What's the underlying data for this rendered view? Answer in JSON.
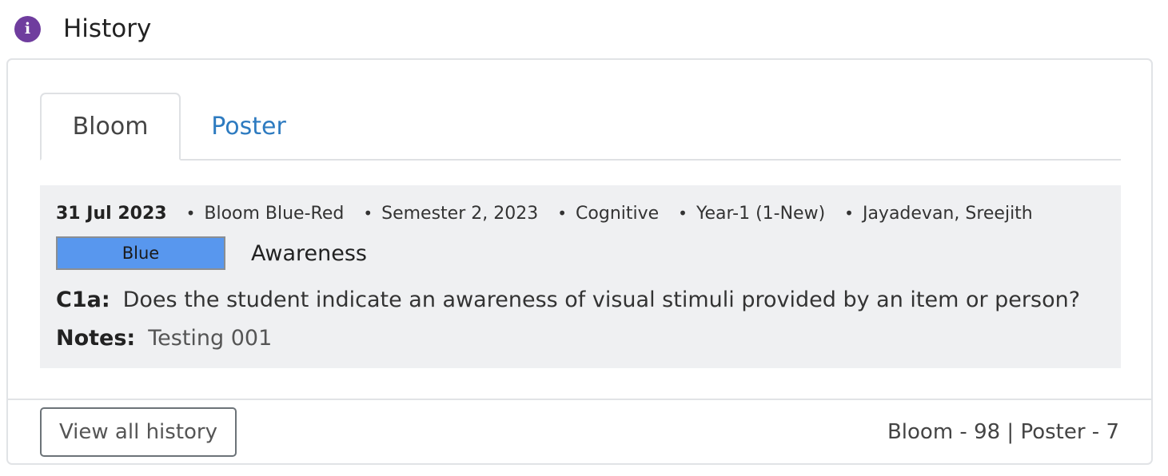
{
  "header": {
    "title": "History",
    "icon": "info-icon",
    "icon_glyph": "i"
  },
  "tabs": [
    {
      "label": "Bloom",
      "active": true
    },
    {
      "label": "Poster",
      "active": false
    }
  ],
  "entry": {
    "date": "31 Jul 2023",
    "meta": [
      "Bloom Blue-Red",
      "Semester 2, 2023",
      "Cognitive",
      "Year-1 (1-New)",
      "Jayadevan, Sreejith"
    ],
    "bullet": "•",
    "badge": {
      "label": "Blue",
      "color": "#5897ee"
    },
    "level_name": "Awareness",
    "question_code": "C1a:",
    "question_text": "Does the student indicate an awareness of visual stimuli provided by an item or person?",
    "notes_label": "Notes:",
    "notes_value": "Testing 001"
  },
  "footer": {
    "view_all_label": "View all history",
    "counts_text": "Bloom - 98 | Poster - 7"
  },
  "colors": {
    "accent": "#2e7bc0",
    "info_icon": "#6f3d9e",
    "entry_bg": "#eff0f2"
  }
}
